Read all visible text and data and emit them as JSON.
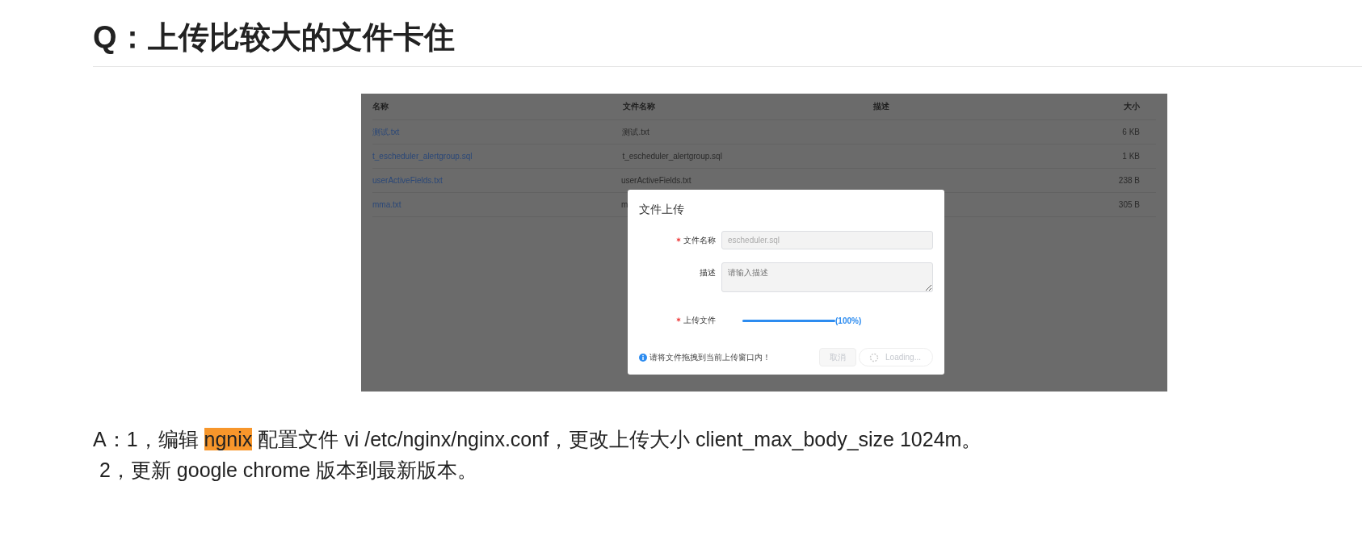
{
  "heading": "Q：上传比较大的文件卡住",
  "screenshot": {
    "table": {
      "columns": [
        "名称",
        "文件名称",
        "描述",
        "大小"
      ],
      "rows": [
        {
          "name": "测试.txt",
          "file_name": "测试.txt",
          "size": "6 KB"
        },
        {
          "name": "t_escheduler_alertgroup.sql",
          "file_name": "t_escheduler_alertgroup.sql",
          "size": "1 KB"
        },
        {
          "name": "userActiveFields.txt",
          "file_name": "userActiveFields.txt",
          "size": "238 B"
        },
        {
          "name": "mma.txt",
          "file_name": "m",
          "size": "305 B"
        }
      ]
    },
    "dialog": {
      "title": "文件上传",
      "file_name": {
        "label": "文件名称",
        "required": true,
        "value": "escheduler.sql"
      },
      "description": {
        "label": "描述",
        "required": false,
        "placeholder": "请输入描述"
      },
      "upload": {
        "label": "上传文件",
        "required": true,
        "level": 1,
        "reading": "(100%)"
      },
      "hint": "请将文件拖拽到当前上传窗口内！",
      "buttons": [
        {
          "label": "取消",
          "kind": "cancel",
          "disabled": true
        },
        {
          "label": "Loading...",
          "kind": "loading",
          "disabled": true
        }
      ]
    }
  },
  "answer": [
    {
      "parts": [
        {
          "text": "A：1，编辑 ",
          "highlight": false
        },
        {
          "text": "ngnix",
          "highlight": true
        },
        {
          "text": " 配置文件 vi /etc/nginx/nginx.conf，更改上传大小 client_max_body_size 1024m。",
          "highlight": false
        }
      ]
    },
    {
      "parts": [
        {
          "text": "2，更新 google chrome 版本到最新版本。",
          "highlight": false
        }
      ]
    }
  ]
}
